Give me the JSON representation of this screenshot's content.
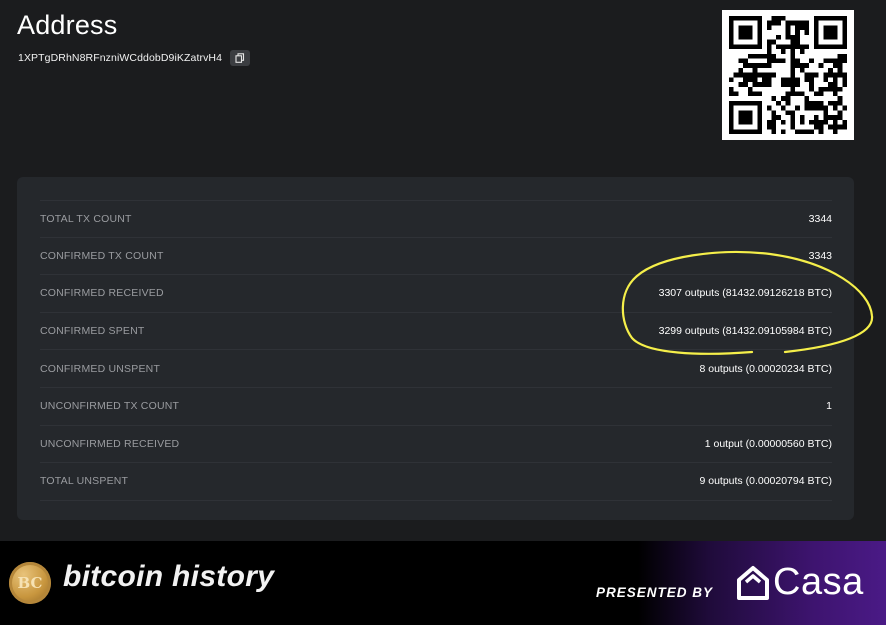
{
  "header": {
    "title": "Address",
    "address": "1XPTgDRhN8RFnzniWCddobD9iKZatrvH4",
    "copy_icon": "copy-icon",
    "qr_icon": "qr-code"
  },
  "stats": [
    {
      "label": "TOTAL TX COUNT",
      "value": "3344"
    },
    {
      "label": "CONFIRMED TX COUNT",
      "value": "3343"
    },
    {
      "label": "CONFIRMED RECEIVED",
      "value": "3307 outputs (81432.09126218 BTC)"
    },
    {
      "label": "CONFIRMED SPENT",
      "value": "3299 outputs (81432.09105984 BTC)"
    },
    {
      "label": "CONFIRMED UNSPENT",
      "value": "8 outputs (0.00020234 BTC)"
    },
    {
      "label": "UNCONFIRMED TX COUNT",
      "value": "1"
    },
    {
      "label": "UNCONFIRMED RECEIVED",
      "value": "1 output (0.00000560 BTC)"
    },
    {
      "label": "TOTAL UNSPENT",
      "value": "9 outputs (0.00020794 BTC)"
    }
  ],
  "annotation": {
    "color": "#f5ef4a"
  },
  "footer": {
    "logo_text": "BC",
    "brand": "bitcoin history",
    "presented_by": "PRESENTED BY",
    "sponsor": "Casa",
    "accent": "#4a1a86"
  }
}
